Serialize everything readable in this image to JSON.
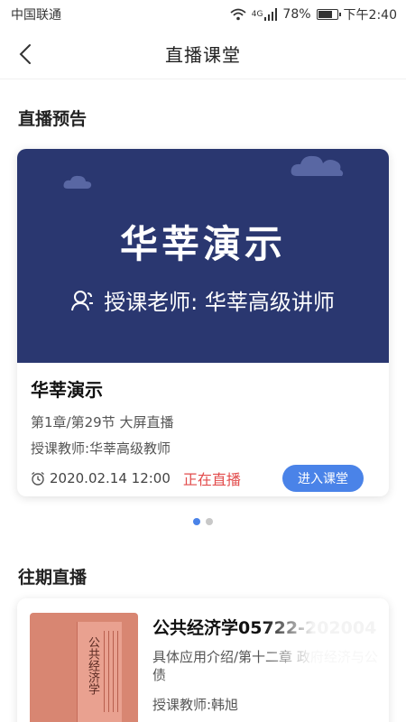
{
  "status_bar": {
    "carrier": "中国联通",
    "network": "4G",
    "battery": "78%",
    "time": "下午2:40"
  },
  "nav": {
    "title": "直播课堂"
  },
  "preview_section": {
    "title": "直播预告",
    "card": {
      "banner_title": "华莘演示",
      "banner_teacher": "授课老师: 华莘高级讲师",
      "title": "华莘演示",
      "chapter": "第1章/第29节 大屏直播",
      "teacher": "授课教师:华莘高级教师",
      "time": "2020.02.14 12:00",
      "status": "正在直播",
      "enter_button": "进入课堂"
    },
    "carousel": {
      "count": 2,
      "active": 1
    }
  },
  "past_section": {
    "title": "往期直播",
    "card": {
      "cover_text": "公共经济学",
      "title": "公共经济学05722-202004",
      "desc": "具体应用介绍/第十二章 政府经济与公债",
      "teacher": "授课教师:韩旭"
    }
  },
  "colors": {
    "accent": "#4a83e8",
    "live": "#e24b4b",
    "banner": "#2a3770"
  }
}
